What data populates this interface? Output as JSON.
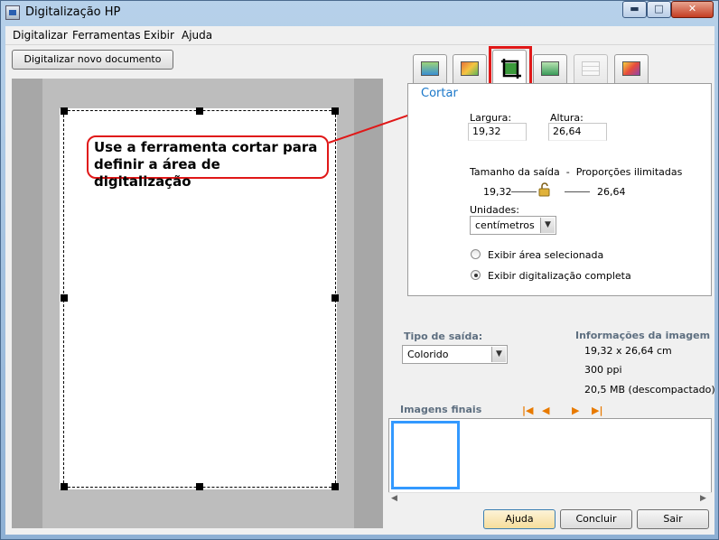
{
  "window": {
    "title": "Digitalização HP",
    "controls": {
      "minimize": "▬",
      "maximize": "□",
      "close": "✕"
    }
  },
  "menu": [
    "Digitalizar",
    "Ferramentas",
    "Exibir",
    "Ajuda"
  ],
  "scan_new_button": "Digitalizar novo documento",
  "callout_text": "Use a ferramenta cortar para definir a área de digitalização",
  "tabs": [
    {
      "name": "scan-settings-tab-icon"
    },
    {
      "name": "color-adjust-tab-icon"
    },
    {
      "name": "crop-tab-icon",
      "active": true
    },
    {
      "name": "output-arrow-tab-icon"
    },
    {
      "name": "sliders-tab-icon",
      "disabled": true
    },
    {
      "name": "magic-wand-tab-icon"
    }
  ],
  "crop": {
    "title": "Cortar",
    "width_label": "Largura:",
    "width_value": "19,32",
    "height_label": "Altura:",
    "height_value": "26,64",
    "output_size_label": "Tamanho da saída  -  Proporções ilimitadas",
    "output_width": "19,32",
    "output_height": "26,64",
    "units_label": "Unidades:",
    "units_value": "centímetros",
    "radio_selected_area": "Exibir área selecionada",
    "radio_full_scan": "Exibir digitalização completa"
  },
  "output": {
    "label": "Tipo de saída:",
    "value": "Colorido"
  },
  "image_info": {
    "title": "Informações da imagem",
    "dimensions": "19,32 x 26,64 cm",
    "resolution": "300 ppi",
    "size": "20,5 MB (descompactado)"
  },
  "final_images": {
    "title": "Imagens finais",
    "nav": [
      "|◀",
      "◀",
      "▶",
      "▶|"
    ]
  },
  "buttons": {
    "help": "Ajuda",
    "finish": "Concluir",
    "exit": "Sair"
  },
  "colors": {
    "accent_blue": "#1a77c9",
    "highlight_red": "#e01818",
    "nav_orange": "#e87a00"
  }
}
